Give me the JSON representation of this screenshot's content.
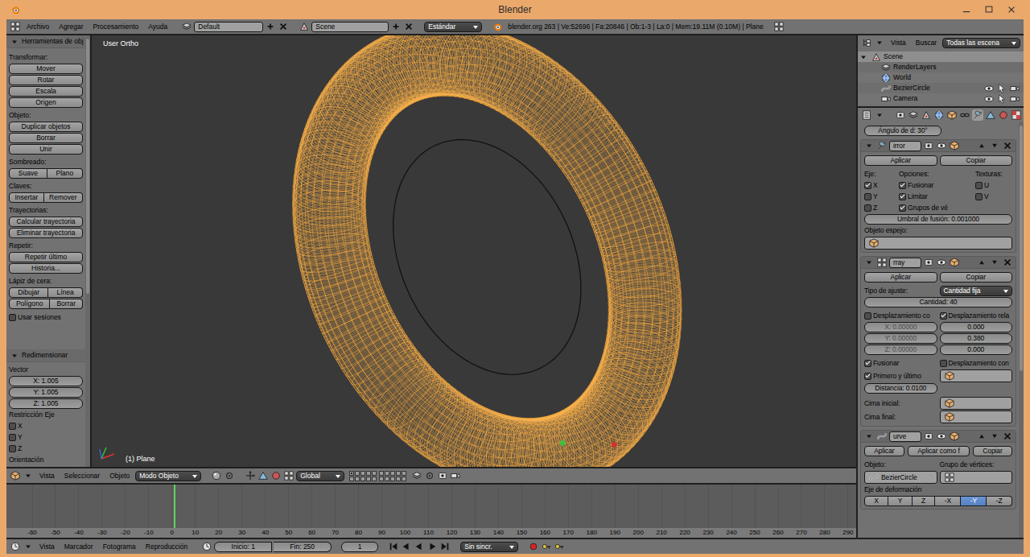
{
  "window": {
    "title": "Blender"
  },
  "info_header": {
    "menus": [
      "Archivo",
      "Agregar",
      "Procesamiento",
      "Ayuda"
    ],
    "layout": "Default",
    "scene": "Scene",
    "engine": "Estándar",
    "stats": "blender.org 263 | Ve:52696 | Fa:20846 | Ob:1-3 | La:0 | Mem:19.11M (0.10M) | Plane"
  },
  "toolbar": {
    "title": "Herramientas de obj",
    "expanded": true,
    "sections": [
      {
        "label": "Transformar:",
        "rows": [
          [
            "Mover"
          ],
          [
            "Rotar"
          ],
          [
            "Escala"
          ],
          [
            "Origen"
          ]
        ]
      },
      {
        "label": "Objeto:",
        "rows": [
          [
            "Duplicar objetos"
          ],
          [
            "Borrar"
          ],
          [
            "Unir"
          ]
        ]
      },
      {
        "label": "Sombreado:",
        "rows": [
          [
            "Suave",
            "Plano"
          ]
        ]
      },
      {
        "label": "Claves:",
        "rows": [
          [
            "Insertar",
            "Remover"
          ]
        ]
      },
      {
        "label": "Trayectorias:",
        "rows": [
          [
            "Calcular trayectoria"
          ],
          [
            "Eliminar trayectoria"
          ]
        ]
      },
      {
        "label": "Repetir:",
        "rows": [
          [
            "Repetir último"
          ],
          [
            "Historia..."
          ]
        ]
      },
      {
        "label": "Lápiz de cera:",
        "rows": [
          [
            "Dibujar",
            "Línea"
          ],
          [
            "Polígono",
            "Borrar"
          ]
        ]
      }
    ],
    "use_sessions": {
      "label": "Usar sesiones",
      "checked": false
    }
  },
  "redo": {
    "title": "Redimensionar",
    "expanded": true,
    "vector_label": "Vector",
    "fields": [
      "X: 1.005",
      "Y: 1.005",
      "Z: 1.005"
    ],
    "constraint_label": "Restricción Eje",
    "axes": [
      {
        "label": "X",
        "checked": false
      },
      {
        "label": "Y",
        "checked": false
      },
      {
        "label": "Z",
        "checked": false
      }
    ],
    "orientation_label": "Orientación"
  },
  "viewport": {
    "view_name": "User Ortho",
    "object_label": "(1) Plane"
  },
  "view3d_header": {
    "menus": [
      "Vista",
      "Seleccionar",
      "Objeto"
    ],
    "mode": "Modo Objeto",
    "orientation": "Global",
    "layers": [
      {
        "selected": true
      },
      {
        "selected": false
      },
      {
        "selected": false
      },
      {
        "selected": false
      },
      {
        "selected": false
      },
      {
        "selected": false
      },
      {
        "selected": false
      },
      {
        "selected": false
      },
      {
        "selected": false
      },
      {
        "selected": false
      },
      {
        "selected": false
      },
      {
        "selected": false
      },
      {
        "selected": false
      },
      {
        "selected": false
      },
      {
        "selected": false
      },
      {
        "selected": false
      },
      {
        "selected": false
      },
      {
        "selected": false
      },
      {
        "selected": false
      },
      {
        "selected": false
      }
    ]
  },
  "timeline": {
    "ticks": [
      "-60",
      "-50",
      "-40",
      "-30",
      "-20",
      "-10",
      "0",
      "10",
      "20",
      "30",
      "40",
      "50",
      "60",
      "70",
      "80",
      "90",
      "100",
      "110",
      "120",
      "130",
      "140",
      "150",
      "160",
      "170",
      "180",
      "190",
      "200",
      "210",
      "220",
      "230",
      "240",
      "250",
      "260",
      "270",
      "280",
      "290"
    ]
  },
  "timeline_header": {
    "menus": [
      "Vista",
      "Marcador",
      "Fotograma",
      "Reproducción"
    ],
    "start": "Inicio: 1",
    "end": "Fin: 250",
    "frame": "1",
    "sync": "Sin sincr."
  },
  "outliner": {
    "menus": [
      "Vista",
      "Buscar"
    ],
    "filter": "Todas las escena",
    "tree": {
      "label": "Scene",
      "expanded": true,
      "selected": true,
      "children": [
        {
          "label": "RenderLayers",
          "selected": false
        },
        {
          "label": "World",
          "selected": false
        },
        {
          "label": "BezierCircle",
          "selected": false,
          "visible": true,
          "selectable": true,
          "renderable": true
        },
        {
          "label": "Camera",
          "selected": false,
          "visible": true,
          "selectable": true,
          "renderable": true
        }
      ]
    }
  },
  "properties": {
    "tabs": [
      {
        "selected": false
      },
      {
        "selected": false
      },
      {
        "selected": false
      },
      {
        "selected": false
      },
      {
        "selected": false
      },
      {
        "selected": false
      },
      {
        "selected": true
      },
      {
        "selected": false
      },
      {
        "selected": false
      },
      {
        "selected": false
      },
      {
        "selected": false
      },
      {
        "selected": false
      }
    ],
    "partial_field": "Ángulo de d: 30°",
    "mirror": {
      "name": "irror",
      "expanded": true,
      "apply": "Aplicar",
      "copy": "Copiar",
      "axis_label": "Eje:",
      "axes": [
        {
          "label": "X",
          "checked": true
        },
        {
          "label": "Y",
          "checked": false
        },
        {
          "label": "Z",
          "checked": false
        }
      ],
      "options_label": "Opciones:",
      "options": [
        {
          "label": "Fusionar",
          "checked": true
        },
        {
          "label": "Limitar",
          "checked": true
        },
        {
          "label": "Grupos de vé",
          "checked": true
        }
      ],
      "textures_label": "Texturas:",
      "textures": [
        {
          "label": "U",
          "checked": false
        },
        {
          "label": "V",
          "checked": false
        }
      ],
      "merge_limit": "Umbral de fusión: 0.001000",
      "mirror_object_label": "Objeto espejo:"
    },
    "array": {
      "name": "rray",
      "expanded": true,
      "apply": "Aplicar",
      "copy": "Copiar",
      "fit_label": "Tipo de ajuste:",
      "fit_type": "Cantidad fija",
      "count": "Cantidad: 40",
      "constant": {
        "label": "Desplazamiento co",
        "checked": false,
        "fields": [
          "X: 0.00000",
          "Y: 0.00000",
          "Z: 0.00000"
        ]
      },
      "relative": {
        "label": "Desplazamiento rela",
        "checked": true,
        "fields": [
          "0.000",
          "0.380",
          "0.000"
        ]
      },
      "merge": {
        "label": "Fusionar",
        "checked": true
      },
      "object_offset": {
        "label": "Desplazamiento con",
        "checked": false
      },
      "first_last": {
        "label": "Primero y último",
        "checked": true
      },
      "distance": "Distancia: 0.0100",
      "start_cap": "Cima inicial:",
      "end_cap": "Cima final:"
    },
    "curve": {
      "name": "urve",
      "expanded": true,
      "buttons": [
        "Aplicar",
        "Aplicar como f",
        "Copiar"
      ],
      "object_label": "Objeto:",
      "object": "BezierCircle",
      "vgroup_label": "Grupo de vértices:",
      "axis_label": "Eje de deformación",
      "axes": [
        {
          "label": "X",
          "selected": false
        },
        {
          "label": "Y",
          "selected": false
        },
        {
          "label": "Z",
          "selected": false
        },
        {
          "label": "-X",
          "selected": false
        },
        {
          "label": "-Y",
          "selected": true
        },
        {
          "label": "-Z",
          "selected": false
        }
      ]
    }
  }
}
